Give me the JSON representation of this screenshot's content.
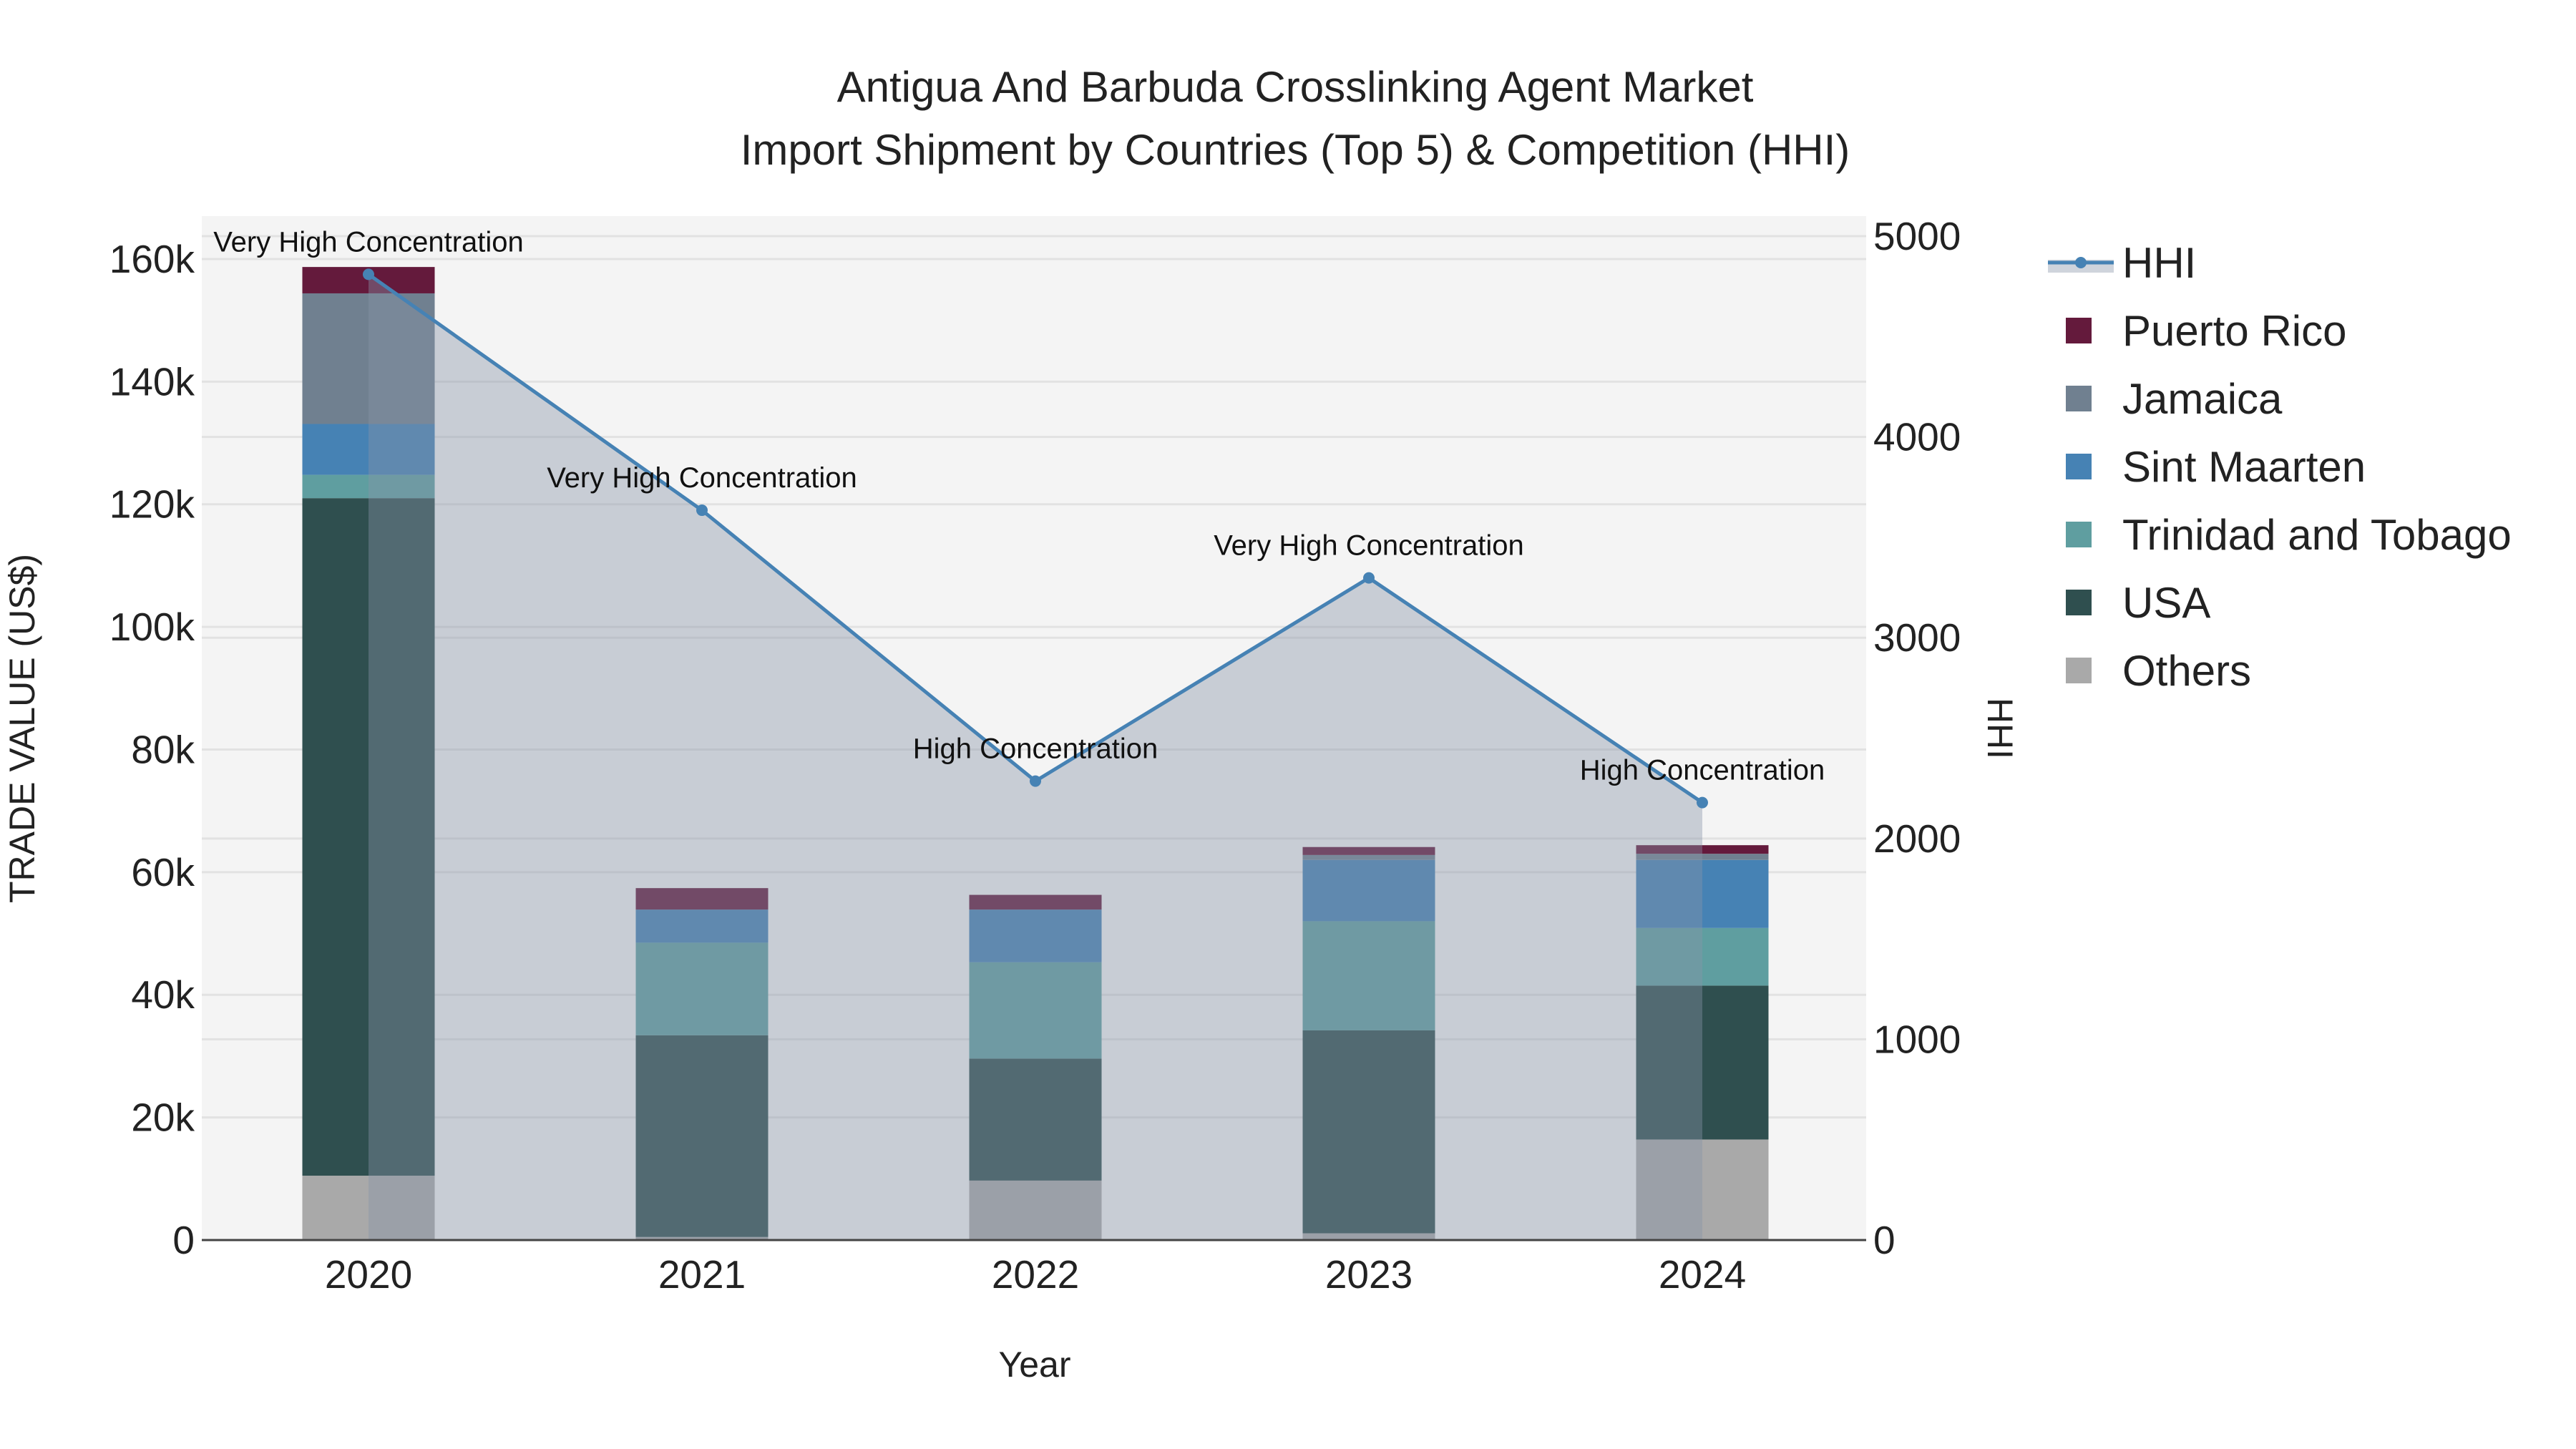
{
  "chart_data": {
    "type": "bar",
    "stacked": true,
    "title": [
      "Antigua And Barbuda Crosslinking Agent Market",
      "Import Shipment by Countries (Top 5) & Competition (HHI)"
    ],
    "xlabel": "Year",
    "ylabel": "TRADE VALUE (US$)",
    "y2label": "HHI",
    "categories": [
      "2020",
      "2021",
      "2022",
      "2023",
      "2024"
    ],
    "ylim": [
      0,
      167000
    ],
    "y2lim": [
      0,
      5100
    ],
    "yticks": [
      0,
      20000,
      40000,
      60000,
      80000,
      100000,
      120000,
      140000,
      160000
    ],
    "ytick_labels": [
      "0",
      "20k",
      "40k",
      "60k",
      "80k",
      "100k",
      "120k",
      "140k",
      "160k"
    ],
    "y2ticks": [
      0,
      1000,
      2000,
      3000,
      4000,
      5000
    ],
    "y2tick_labels": [
      "0",
      "1000",
      "2000",
      "3000",
      "4000",
      "5000"
    ],
    "grid": true,
    "legend_position": "right",
    "series": [
      {
        "name": "Others",
        "color": "#a9a9a9",
        "values": [
          10500,
          500,
          9700,
          1100,
          16400
        ]
      },
      {
        "name": "USA",
        "color": "#2f4f4f",
        "values": [
          110500,
          32900,
          19900,
          33100,
          25100
        ]
      },
      {
        "name": "Trinidad and Tobago",
        "color": "#5f9ea0",
        "values": [
          3800,
          15100,
          15700,
          17800,
          9400
        ]
      },
      {
        "name": "Sint Maarten",
        "color": "#4682b4",
        "values": [
          8300,
          5400,
          8600,
          10000,
          11100
        ]
      },
      {
        "name": "Jamaica",
        "color": "#708090",
        "values": [
          21300,
          0,
          0,
          800,
          1000
        ]
      },
      {
        "name": "Puerto Rico",
        "color": "#641a3c",
        "values": [
          4300,
          3500,
          2400,
          1300,
          1400
        ]
      }
    ],
    "line_series": {
      "name": "HHI",
      "color": "#4682b4",
      "values": [
        4810,
        3635,
        2286,
        3298,
        2179
      ],
      "annotations": [
        "Very High Concentration",
        "Very High Concentration",
        "High Concentration",
        "Very High Concentration",
        "High Concentration"
      ]
    },
    "legend_order": [
      "HHI",
      "Puerto Rico",
      "Jamaica",
      "Sint Maarten",
      "Trinidad and Tobago",
      "USA",
      "Others"
    ]
  }
}
